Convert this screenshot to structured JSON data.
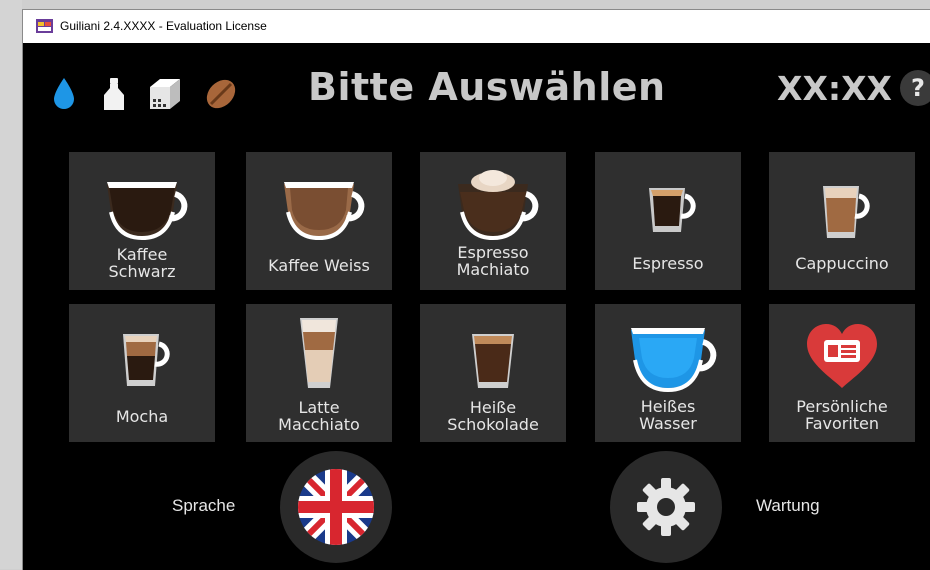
{
  "window": {
    "title": "Guiliani 2.4.XXXX - Evaluation License"
  },
  "header": {
    "title": "Bitte Auswählen",
    "clock": "XX:XX",
    "help_label": "?",
    "status_icons": [
      "water-drop-icon",
      "milk-bottle-icon",
      "sugar-cube-icon",
      "coffee-bean-icon"
    ]
  },
  "drinks": [
    {
      "label": "Kaffee\nSchwarz",
      "icon": "cup-black-coffee-icon"
    },
    {
      "label": "Kaffee Weiss",
      "icon": "cup-white-coffee-icon"
    },
    {
      "label": "Espresso\nMachiato",
      "icon": "cup-espresso-macchiato-icon"
    },
    {
      "label": "Espresso",
      "icon": "glass-espresso-icon"
    },
    {
      "label": "Cappuccino",
      "icon": "glass-cappuccino-icon"
    },
    {
      "label": "Mocha",
      "icon": "glass-mocha-icon"
    },
    {
      "label": "Latte\nMacchiato",
      "icon": "tall-glass-latte-icon"
    },
    {
      "label": "Heiße\nSchokolade",
      "icon": "glass-hot-chocolate-icon"
    },
    {
      "label": "Heißes\nWasser",
      "icon": "cup-hot-water-icon"
    },
    {
      "label": "Persönliche\nFavoriten",
      "icon": "heart-favorites-icon"
    }
  ],
  "footer": {
    "language_label": "Sprache",
    "language_icon": "uk-flag-icon",
    "maintenance_label": "Wartung",
    "maintenance_icon": "gear-icon"
  },
  "colors": {
    "background": "#000000",
    "tile": "#2f2f2f",
    "text": "#e6e6e6",
    "heading": "#c8c8c8",
    "water": "#1e96e6",
    "heart": "#d93a3a"
  }
}
